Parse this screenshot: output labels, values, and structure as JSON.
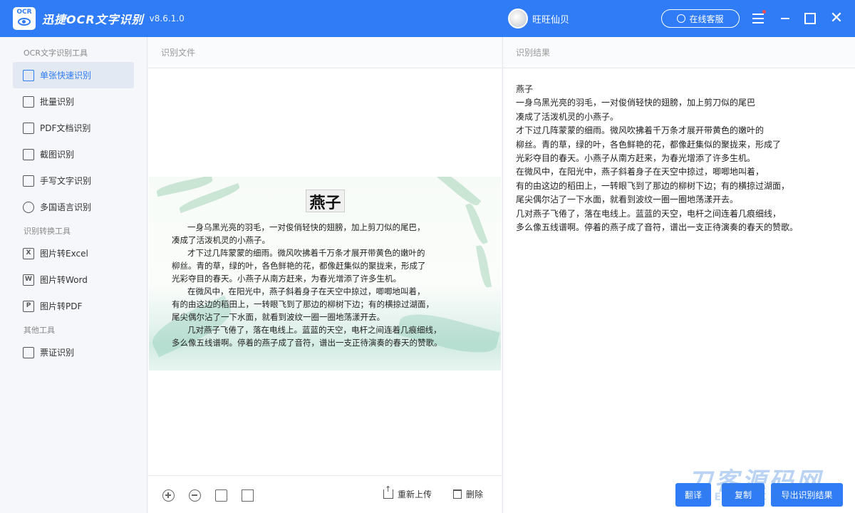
{
  "app": {
    "logo_text": "OCR",
    "title": "迅捷OCR文字识别",
    "version": "v8.6.1.0",
    "user_name": "旺旺仙贝",
    "service_label": "在线客服"
  },
  "sidebar": {
    "groups": [
      {
        "label": "OCR文字识别工具",
        "items": [
          {
            "label": "单张快速识别",
            "icon": "single-image-icon",
            "active": true
          },
          {
            "label": "批量识别",
            "icon": "batch-icon"
          },
          {
            "label": "PDF文档识别",
            "icon": "pdf-doc-icon"
          },
          {
            "label": "截图识别",
            "icon": "crop-icon"
          },
          {
            "label": "手写文字识别",
            "icon": "pen-icon"
          },
          {
            "label": "多国语言识别",
            "icon": "globe-icon"
          }
        ]
      },
      {
        "label": "识别转换工具",
        "items": [
          {
            "label": "图片转Excel",
            "icon": "excel-icon",
            "letter": "X"
          },
          {
            "label": "图片转Word",
            "icon": "word-icon",
            "letter": "W"
          },
          {
            "label": "图片转PDF",
            "icon": "pdf-icon",
            "letter": "P"
          }
        ]
      },
      {
        "label": "其他工具",
        "items": [
          {
            "label": "票证识别",
            "icon": "ticket-icon"
          }
        ]
      }
    ]
  },
  "file_panel": {
    "header": "识别文件",
    "document": {
      "title": "燕子",
      "lines": [
        "一身乌黑光亮的羽毛，一对俊俏轻快的翅膀，加上剪刀似的尾巴，",
        "凑成了活泼机灵的小燕子。",
        "才下过几阵蒙蒙的细雨。微风吹拂着千万条才展开带黄色的嫩叶的",
        "柳丝。青的草，绿的叶，各色鲜艳的花，都像赶集似的聚拢来，形成了",
        "光彩夺目的春天。小燕子从南方赶来，为春光增添了许多生机。",
        "在微风中，在阳光中，燕子斜着身子在天空中掠过，唧唧地叫着，",
        "有的由这边的稻田上，一转眼飞到了那边的柳树下边；有的横掠过湖面，",
        "尾尖偶尔沾了一下水面，就看到波纹一圈一圈地荡漾开去。",
        "几对燕子飞倦了，落在电线上。蓝蓝的天空，电杆之间连着几痕细线，",
        "多么像五线谱啊。停着的燕子成了音符，谱出一支正待演奏的春天的赞歌。"
      ]
    },
    "toolbar": {
      "reupload_label": "重新上传",
      "delete_label": "删除"
    }
  },
  "result_panel": {
    "header": "识别结果",
    "lines": [
      "燕子",
      "一身乌黑光亮的羽毛，一对俊俏轻快的翅膀，加上剪刀似的尾巴",
      "凑成了活泼机灵的小燕子。",
      "才下过几阵蒙蒙的细雨。微风吹拂着千万条才展开带黄色的嫩叶的",
      "柳丝。青的草，绿的叶，各色鲜艳的花，都像赶集似的聚拢来，形成了",
      "光彩夺目的春天。小燕子从南方赶来，为春光增添了许多生机。",
      "在微风中，在阳光中，燕子斜着身子在天空中掠过，唧唧地叫着，",
      "有的由这边的稻田上，一转眼飞到了那边的柳树下边；有的横掠过湖面，",
      "尾尖偶尔沾了一下水面，就看到波纹一圈一圈地荡漾开去。",
      "几对燕子飞倦了，落在电线上。蓝蓝的天空，电杆之间连着几痕细线，",
      "多么像五线谱啊。停着的燕子成了音符，谱出一支正待演奏的春天的赞歌。"
    ],
    "buttons": {
      "translate": "翻译",
      "copy": "复制",
      "export": "导出识别结果"
    }
  },
  "watermark": {
    "text": "刀客源码网",
    "sub": "DKEWL.COM"
  },
  "colors": {
    "accent": "#2f7cf6",
    "sidebar_active_bg": "#e3e9f3"
  }
}
